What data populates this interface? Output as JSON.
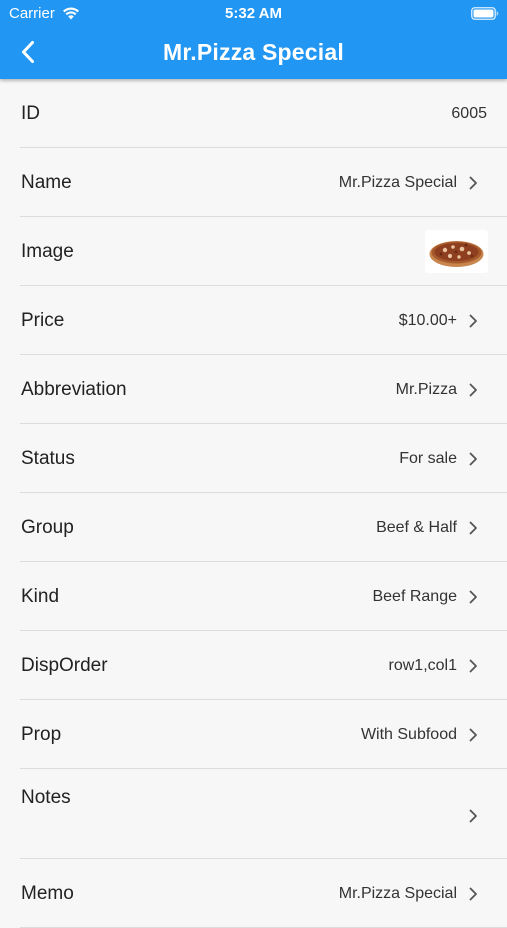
{
  "status_bar": {
    "carrier": "Carrier",
    "time": "5:32 AM"
  },
  "nav": {
    "title": "Mr.Pizza Special",
    "back_icon": "chevron-left-icon"
  },
  "colors": {
    "header": "#2196f3",
    "background": "#f7f7f7",
    "divider": "#dcdcdc"
  },
  "rows": [
    {
      "label": "ID",
      "value": "6005"
    },
    {
      "label": "Name",
      "value": "Mr.Pizza Special"
    },
    {
      "label": "Image",
      "value": "",
      "image": "pizza-thumbnail"
    },
    {
      "label": "Price",
      "value": "$10.00+"
    },
    {
      "label": "Abbreviation",
      "value": "Mr.Pizza"
    },
    {
      "label": "Status",
      "value": "For sale"
    },
    {
      "label": "Group",
      "value": "Beef & Half"
    },
    {
      "label": "Kind",
      "value": "Beef Range"
    },
    {
      "label": "DispOrder",
      "value": "row1,col1"
    },
    {
      "label": "Prop",
      "value": "With Subfood"
    },
    {
      "label": "Notes",
      "value": ""
    },
    {
      "label": "Memo",
      "value": "Mr.Pizza Special"
    }
  ]
}
